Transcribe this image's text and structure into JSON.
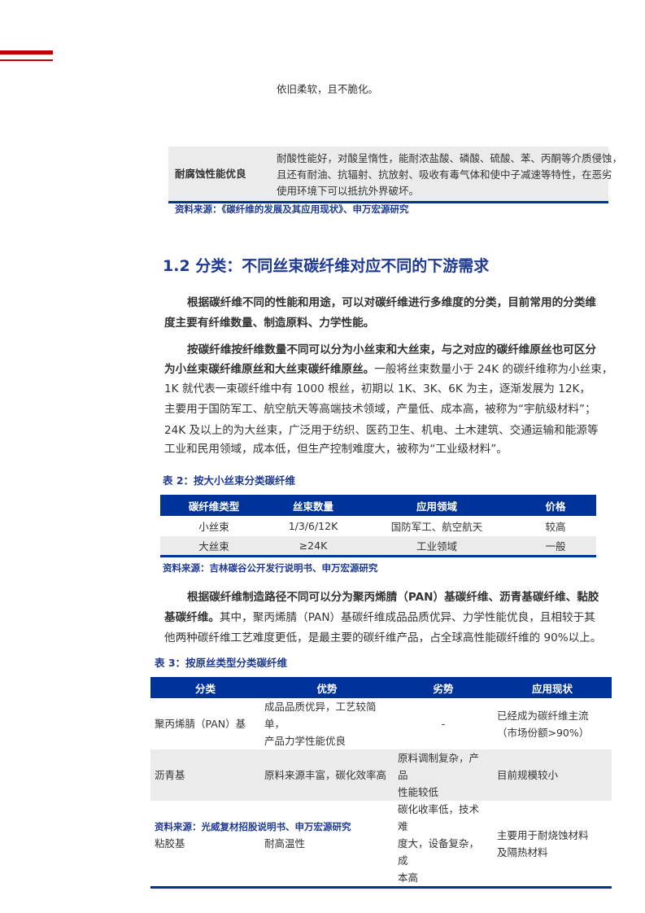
{
  "top_table": {
    "prev_text": "依旧柔软，且不脆化。",
    "row_label": "耐腐蚀性能优良",
    "row_lines": [
      "耐酸性能好，对酸呈惰性，能耐浓盐酸、磷酸、硫酸、苯、丙酮等介质侵蚀，",
      "且还有耐油、抗辐射、抗放射、吸收有毒气体和使中子减速等特性，在恶劣",
      "使用环境下可以抵抗外界破坏。"
    ],
    "source": "资料来源：《碳纤维的发展及其应用现状》、申万宏源研究"
  },
  "heading": "1.2 分类：不同丝束碳纤维对应不同的下游需求",
  "para1": [
    {
      "b": "根据碳纤维不同的性能和用途，可以对碳纤维进行多维度的分类，目前常用的分类维",
      "t": ""
    },
    {
      "b": "度主要有纤维数量、制造原料、力学性能。",
      "t": ""
    }
  ],
  "para2": [
    {
      "b": "按碳纤维按纤维数量不同可以分为小丝束和大丝束，与之对应的碳纤维原丝也可区分",
      "t": ""
    },
    {
      "b": "为小丝束碳纤维原丝和大丝束碳纤维原丝。",
      "t": "一般将丝束数量小于 24K 的碳纤维称为小丝束，"
    },
    {
      "b": "",
      "t": "1K 就代表一束碳纤维中有 1000 根丝，初期以 1K、3K、6K 为主，逐渐发展为 12K，"
    },
    {
      "b": "",
      "t": "主要用于国防军工、航空航天等高端技术领域，产量低、成本高，被称为“宇航级材料”；"
    },
    {
      "b": "",
      "t": "24K 及以上的为大丝束，广泛用于纺织、医药卫生、机电、土木建筑、交通运输和能源等"
    },
    {
      "b": "",
      "t": "工业和民用领域，成本低，但生产控制难度大，被称为“工业级材料”。"
    }
  ],
  "table2": {
    "title": "表 2：按大小丝束分类碳纤维",
    "headers": [
      "碳纤维类型",
      "丝束数量",
      "应用领域",
      "价格"
    ],
    "rows": [
      [
        "小丝束",
        "1/3/6/12K",
        "国防军工、航空航天",
        "较高"
      ],
      [
        "大丝束",
        "≥24K",
        "工业领域",
        "一般"
      ]
    ],
    "source": "资料来源：吉林碳谷公开发行说明书、申万宏源研究"
  },
  "para3": [
    {
      "b": "根据碳纤维制造路径不同可以分为聚丙烯腈（PAN）基碳纤维、沥青基碳纤维、黏胶",
      "t": ""
    },
    {
      "b": "基碳纤维。",
      "t": "其中，聚丙烯腈（PAN）基碳纤维成品品质优异、力学性能优良，且相较于其"
    },
    {
      "b": "",
      "t": "他两种碳纤维工艺难度更低，是最主要的碳纤维产品，占全球高性能碳纤维的 90%以上。"
    }
  ],
  "table3": {
    "title": "表 3：按原丝类型分类碳纤维",
    "headers": [
      "分类",
      "优势",
      "劣势",
      "应用现状"
    ],
    "rows": [
      [
        [
          "聚丙烯腈（PAN）基"
        ],
        [
          "成品品质优异，工艺较简单，",
          "产品力学性能优良"
        ],
        [
          "-"
        ],
        [
          "已经成为碳纤维主流",
          "（市场份额>90%）"
        ]
      ],
      [
        [
          "沥青基"
        ],
        [
          "原料来源丰富，碳化效率高"
        ],
        [
          "原料调制复杂，产品",
          "性能较低"
        ],
        [
          "目前规模较小"
        ]
      ],
      [
        [
          "粘胶基"
        ],
        [
          "耐高温性"
        ],
        [
          "碳化收率低，技术难",
          "度大，设备复杂，成",
          "本高"
        ],
        [
          "主要用于耐烧蚀材料",
          "及隔热材料"
        ]
      ]
    ],
    "source": "资料来源：光威复材招股说明书、申万宏源研究"
  }
}
